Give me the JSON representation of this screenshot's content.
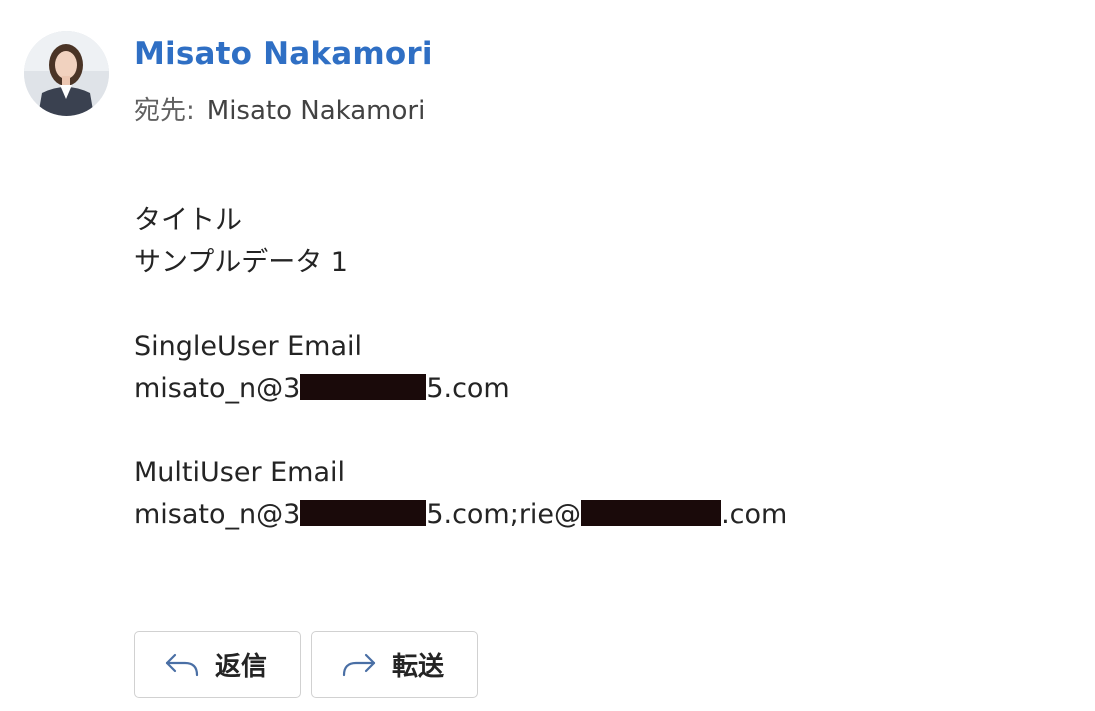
{
  "sender": {
    "name": "Misato Nakamori",
    "avatar_icon": "profile-photo"
  },
  "recipient": {
    "to_label": "宛先:",
    "to_name": "Misato Nakamori"
  },
  "body": {
    "title_label": "タイトル",
    "title_value": "サンプルデータ 1",
    "single_label": "SingleUser Email",
    "single_prefix": "misato_n@3",
    "single_suffix": "5.com",
    "multi_label": "MultiUser Email",
    "multi_prefix": "misato_n@3",
    "multi_middle": "5.com;rie@",
    "multi_suffix": ".com"
  },
  "actions": {
    "reply_label": "返信",
    "forward_label": "転送",
    "reply_icon": "reply-arrow-icon",
    "forward_icon": "forward-arrow-icon"
  },
  "colors": {
    "sender_name": "#2f6fc4",
    "redaction": "#1a0a0a",
    "button_border": "#d1d1d1"
  }
}
